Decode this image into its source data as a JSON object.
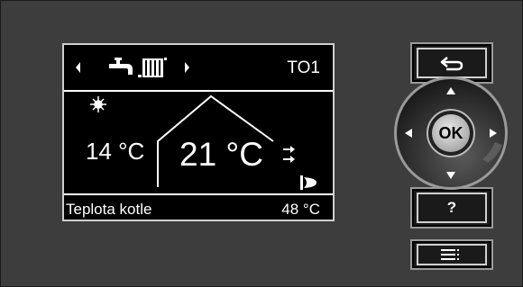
{
  "screen": {
    "tag": "TO1",
    "outdoor_temp": "14 °C",
    "room_temp": "21 °C",
    "footer_label": "Teplota kotle",
    "footer_value": "48 °C",
    "icons": [
      "left-arrow-icon",
      "tap-icon",
      "radiator-icon",
      "right-arrow-icon",
      "sun-icon",
      "flame-icon"
    ]
  },
  "controls": {
    "back_icon": "back-arrow-icon",
    "ok_label": "OK",
    "help_label": "?",
    "menu_icon": "menu-icon"
  },
  "colors": {
    "panel": "#3d3d3d",
    "screen": "#000000",
    "text": "#ffffff"
  }
}
